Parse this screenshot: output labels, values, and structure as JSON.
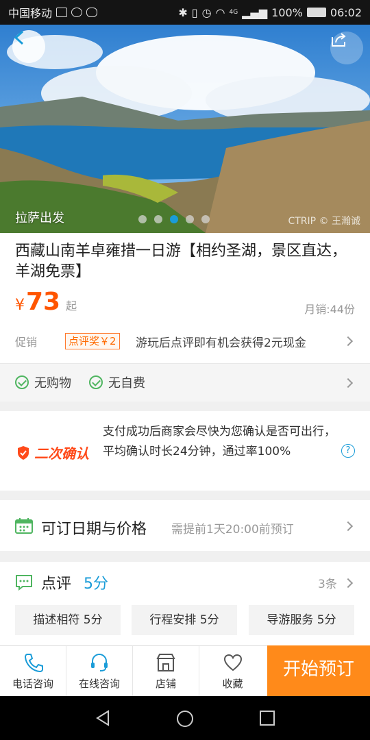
{
  "status_bar": {
    "carrier": "中国移动",
    "network": "4G",
    "battery": "100%",
    "time": "06:02"
  },
  "hero": {
    "origin": "拉萨出发",
    "credit": "CTRIP © 王瀚诚",
    "slide_count": 5,
    "active_slide": 3
  },
  "product": {
    "title": "西藏山南羊卓雍措一日游【相约圣湖，景区直达，羊湖免票】",
    "currency": "¥",
    "price": "73",
    "price_suffix": "起",
    "sales": "月销:44份"
  },
  "promo": {
    "label": "促销",
    "tag": "点评奖￥2",
    "text": "游玩后点评即有机会获得2元现金"
  },
  "features": [
    "无购物",
    "无自费"
  ],
  "confirmation": {
    "badge": "二次确认",
    "text": "支付成功后商家会尽快为您确认是否可出行，平均确认时长24分钟，通过率100%"
  },
  "availability": {
    "title": "可订日期与价格",
    "note": "需提前1天20:00前预订"
  },
  "reviews": {
    "title": "点评",
    "score": "5分",
    "count": "3条",
    "tags": [
      "描述相符 5分",
      "行程安排 5分",
      "导游服务 5分"
    ]
  },
  "bottom_bar": {
    "items": [
      "电话咨询",
      "在线咨询",
      "店铺",
      "收藏"
    ],
    "book_label": "开始预订"
  },
  "colors": {
    "accent": "#1a9cd8",
    "price": "#ff5500",
    "book": "#ff8a1a",
    "check": "#4fb560"
  }
}
